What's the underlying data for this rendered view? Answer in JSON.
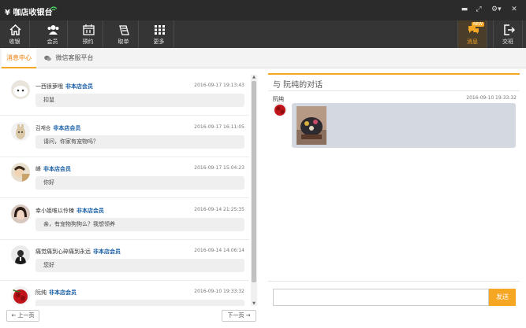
{
  "app": {
    "title": "¥ 咖店收银台"
  },
  "toolbar": {
    "items": [
      {
        "label": "收银",
        "icon": "home-icon"
      },
      {
        "label": "会员",
        "icon": "members-icon"
      },
      {
        "label": "预约",
        "icon": "calendar-icon"
      },
      {
        "label": "取单",
        "icon": "order-icon"
      },
      {
        "label": "更多",
        "icon": "grid-icon"
      }
    ],
    "message": {
      "label": "消息",
      "badge": "NEW",
      "icon": "chat-icon"
    },
    "shift": {
      "label": "交班",
      "icon": "exit-icon"
    }
  },
  "tabs": [
    {
      "label": "消息中心"
    },
    {
      "label": "微信客服平台"
    }
  ],
  "messages": [
    {
      "name": "一西很萝哦",
      "tag": "非本店会员",
      "time": "2016-09-17 19:13:43",
      "text": "扣鼠"
    },
    {
      "name": "김재승",
      "tag": "非本店会员",
      "time": "2016-09-17 16:11:05",
      "text": "请问，你家有宠物吗？"
    },
    {
      "name": "峰",
      "tag": "非本店会员",
      "time": "2016-09-17 15:04:23",
      "text": "你好"
    },
    {
      "name": "幸小姐唯以伶楝",
      "tag": "非本店会员",
      "time": "2016-09-14 21:25:35",
      "text": "亲，有宠物狗狗么？我想领养"
    },
    {
      "name": "痛觉痛到心碎痛到永远",
      "tag": "非本店会员",
      "time": "2016-09-14 14:06:14",
      "text": "您好"
    },
    {
      "name": "阮纯",
      "tag": "非本店会员",
      "time": "2016-09-10 19:33:32",
      "text": ""
    }
  ],
  "pager": {
    "prev": "← 上一页",
    "next": "下一页 →"
  },
  "conversation": {
    "title": "与 阮纯的对话",
    "sender": "阮纯",
    "time": "2016-09-10 19:33:32"
  },
  "composer": {
    "send_label": "发送",
    "placeholder": ""
  },
  "colors": {
    "accent": "#f5a623",
    "member_tag": "#1a5fa6",
    "toolbar_bg": "#353535"
  }
}
